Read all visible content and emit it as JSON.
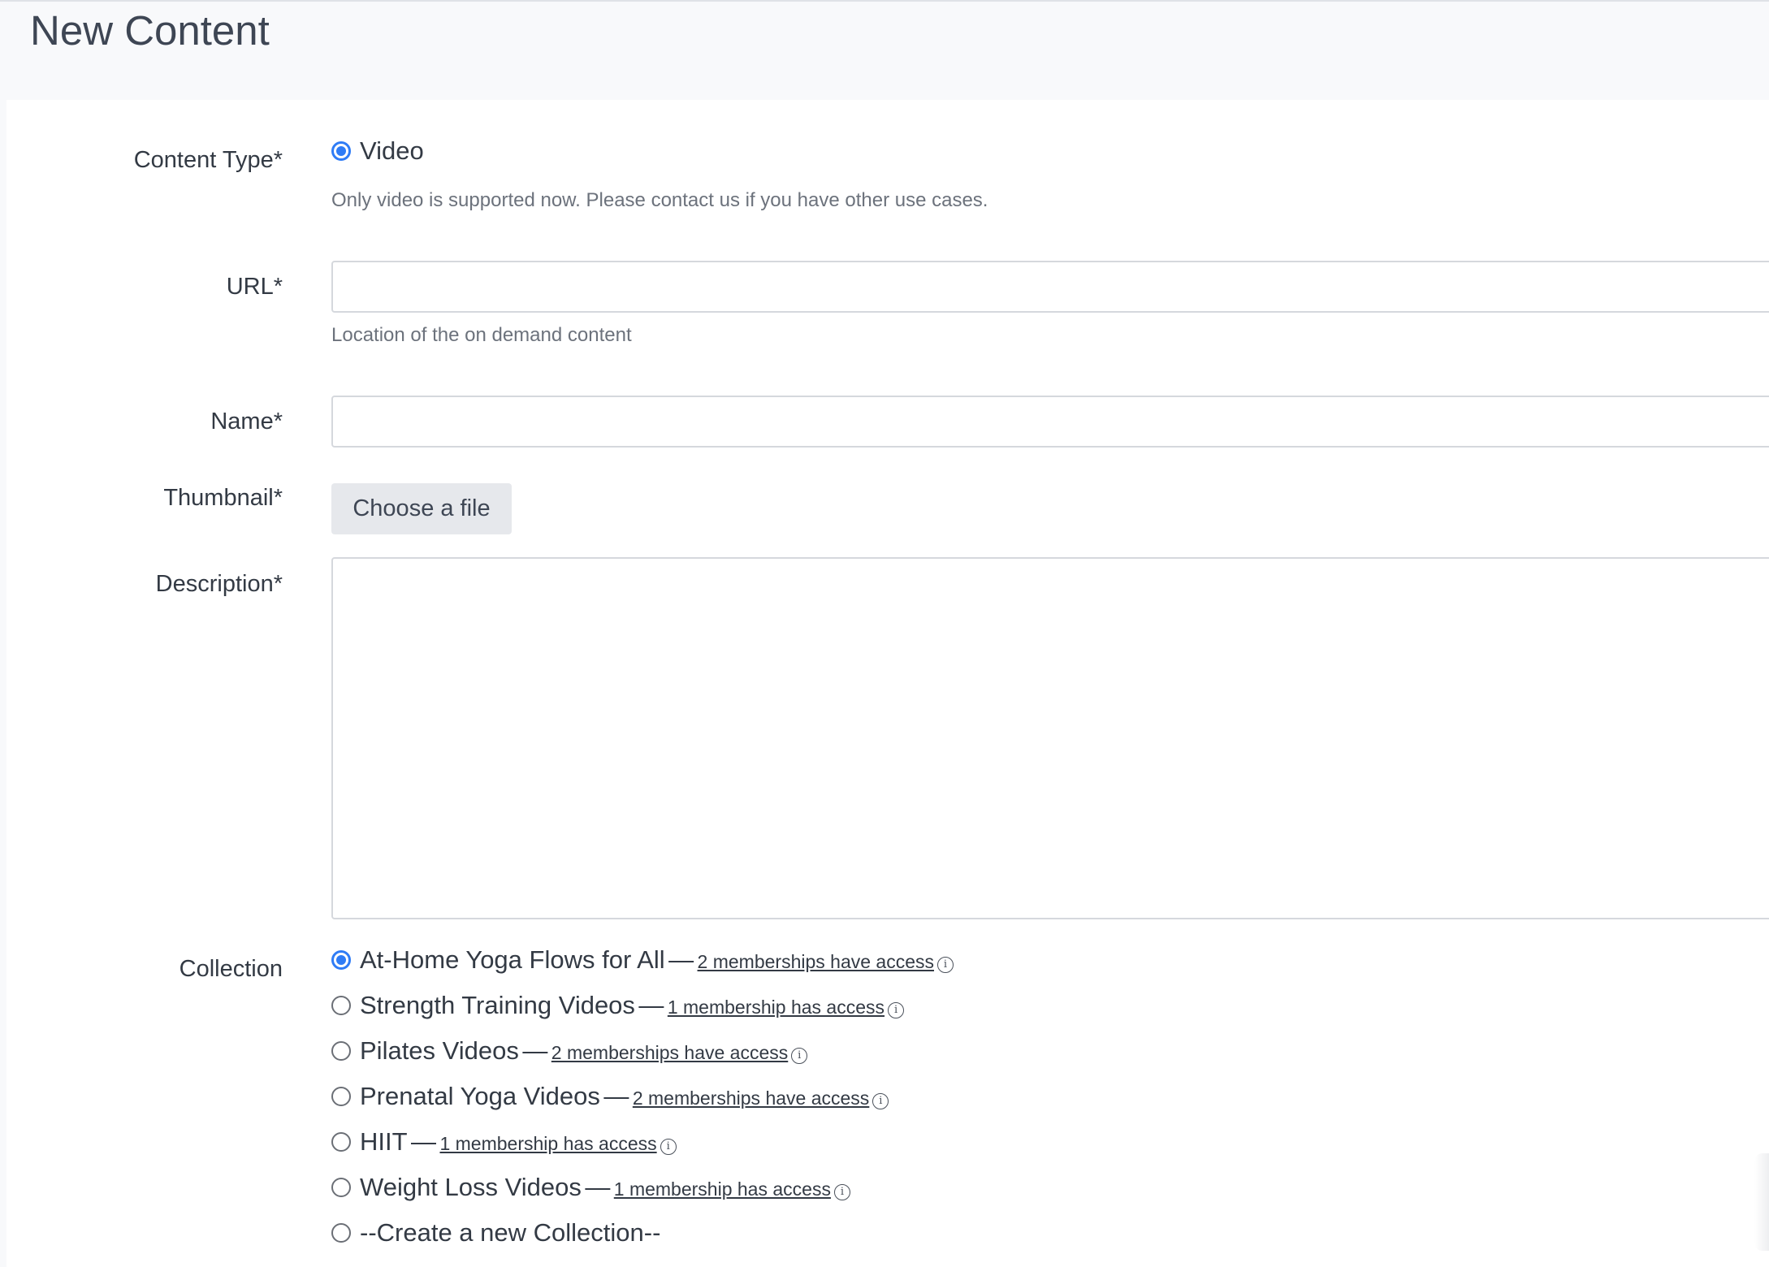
{
  "page": {
    "title": "New Content"
  },
  "form": {
    "content_type": {
      "label": "Content Type*",
      "option_label": "Video",
      "selected": true,
      "help": "Only video is supported now. Please contact us if you have other use cases."
    },
    "url": {
      "label": "URL*",
      "value": "",
      "help": "Location of the on demand content"
    },
    "name": {
      "label": "Name*",
      "value": ""
    },
    "thumbnail": {
      "label": "Thumbnail*",
      "button_label": "Choose a file"
    },
    "description": {
      "label": "Description*",
      "value": ""
    },
    "collection": {
      "label": "Collection",
      "options": [
        {
          "name": "At-Home Yoga Flows for All",
          "dash": "—",
          "access": "2 memberships have access",
          "selected": true
        },
        {
          "name": "Strength Training Videos",
          "dash": "—",
          "access": "1 membership has access",
          "selected": false
        },
        {
          "name": "Pilates Videos",
          "dash": "—",
          "access": "2 memberships have access",
          "selected": false
        },
        {
          "name": "Prenatal Yoga Videos",
          "dash": "—",
          "access": "2 memberships have access",
          "selected": false
        },
        {
          "name": "HIIT",
          "dash": "—",
          "access": "1 membership has access",
          "selected": false
        },
        {
          "name": "Weight Loss Videos",
          "dash": "—",
          "access": "1 membership has access",
          "selected": false
        },
        {
          "name": "--Create a new Collection--",
          "selected": false
        }
      ]
    }
  },
  "colors": {
    "accent": "#2f7cf6",
    "page_bg": "#f8f9fb",
    "card_bg": "#ffffff",
    "text": "#333a44",
    "muted_text": "#6c727c",
    "input_border": "#d5d8dd",
    "button_bg": "#e6e8ec"
  },
  "icons": {
    "info": "info-circle-icon"
  }
}
